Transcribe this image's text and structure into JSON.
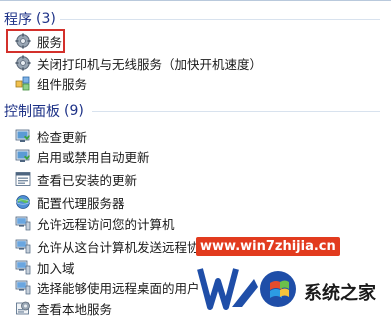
{
  "programs": {
    "title": "程序",
    "count": "(3)",
    "items": [
      {
        "label": "服务",
        "icon": "services-gear-icon"
      },
      {
        "label": "关闭打印机与无线服务（加快开机速度）",
        "icon": "services-gear-icon"
      },
      {
        "label": "组件服务",
        "icon": "component-services-icon"
      }
    ]
  },
  "control_panel": {
    "title": "控制面板",
    "count": "(9)",
    "items": [
      {
        "label": "检查更新",
        "icon": "windows-update-icon"
      },
      {
        "label": "启用或禁用自动更新",
        "icon": "windows-update-icon"
      },
      {
        "label": "查看已安装的更新",
        "icon": "installed-updates-icon"
      },
      {
        "label": "配置代理服务器",
        "icon": "internet-options-icon"
      },
      {
        "label": "允许远程访问您的计算机",
        "icon": "system-icon"
      },
      {
        "label": "允许从这台计算机发送远程协助邀请",
        "icon": "system-icon"
      },
      {
        "label": "加入域",
        "icon": "system-icon"
      },
      {
        "label": "选择能够使用远程桌面的用户",
        "icon": "system-icon"
      },
      {
        "label": "查看本地服务",
        "icon": "admin-tools-icon"
      }
    ]
  },
  "watermark": {
    "url": "www.win7zhijia.cn",
    "brand": "系统之家"
  },
  "colors": {
    "section_header": "#1e3287",
    "highlight": "#d3302b",
    "watermark_blue": "#1f4ea8"
  }
}
